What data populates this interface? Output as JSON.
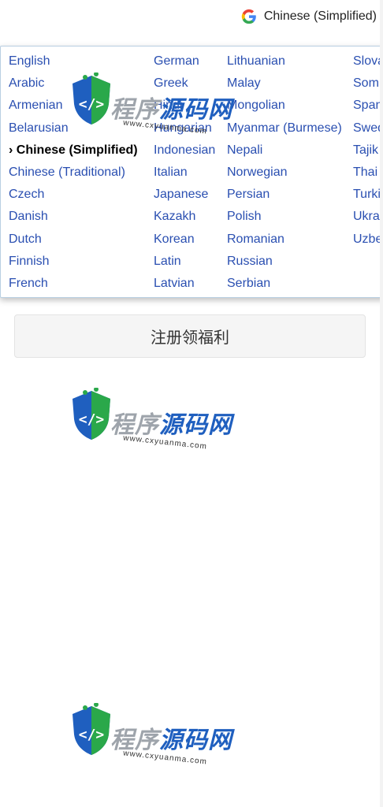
{
  "translate": {
    "current_language": "Chinese (Simplified)",
    "icon": "google-g-icon",
    "columns": [
      [
        "English",
        "Arabic",
        "Armenian",
        "Belarusian",
        "Chinese (Simplified)",
        "Chinese (Traditional)",
        "Czech",
        "Danish",
        "Dutch",
        "Finnish",
        "French"
      ],
      [
        "German",
        "Greek",
        "Hindi",
        "Hungarian",
        "Indonesian",
        "Italian",
        "Japanese",
        "Kazakh",
        "Korean",
        "Latin",
        "Latvian"
      ],
      [
        "Lithuanian",
        "Malay",
        "Mongolian",
        "Myanmar (Burmese)",
        "Nepali",
        "Norwegian",
        "Persian",
        "Polish",
        "Romanian",
        "Russian",
        "Serbian"
      ],
      [
        "Slova",
        "Som",
        "Span",
        "Swed",
        "Tajik",
        "Thai",
        "Turki",
        "Ukra",
        "Uzbe"
      ]
    ],
    "selected_marker": "›",
    "link_color": "#2a4fb1"
  },
  "register_button": {
    "label": "注册领福利"
  },
  "watermark": {
    "text_a": "程序",
    "text_b": "源码网",
    "url": "www.cxyuanma.com"
  }
}
